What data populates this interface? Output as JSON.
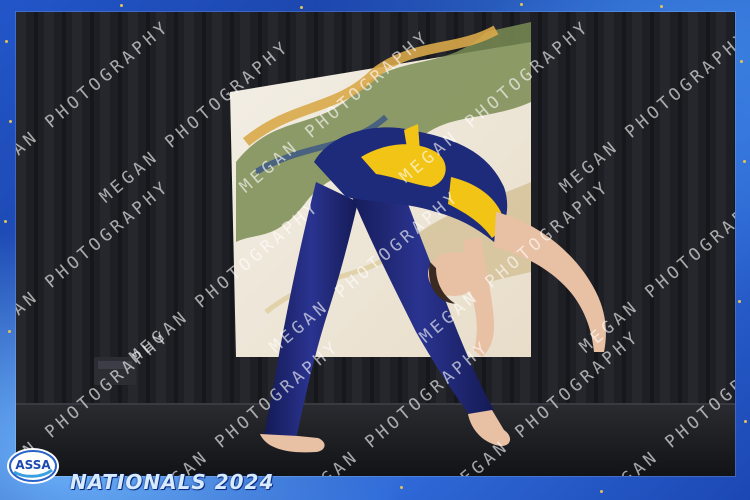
{
  "photo": {
    "description_icon": "dancer-backbend-photo",
    "colors": {
      "frame_blue": "#1d4fb8",
      "costume_navy": "#1e2a7a",
      "costume_yellow": "#f2c416",
      "curtain": "#1b1c20",
      "stage_floor": "#17181c"
    }
  },
  "watermark": {
    "text": "MEGAN PHOTOGRAPHY"
  },
  "logo": {
    "text": "ASSA",
    "icon": "assa-logo-icon"
  },
  "event_title": "NATIONALS 2024"
}
